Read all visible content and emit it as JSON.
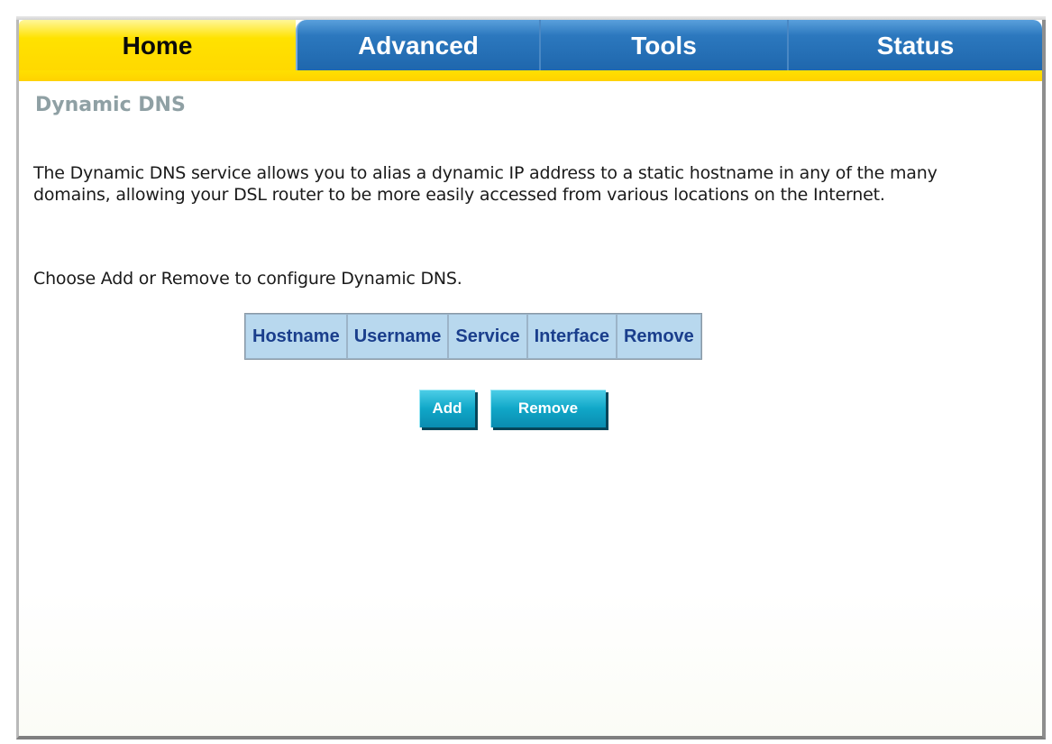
{
  "tabs": {
    "home": "Home",
    "advanced": "Advanced",
    "tools": "Tools",
    "status": "Status"
  },
  "page": {
    "title": "Dynamic DNS",
    "description": "The Dynamic DNS service allows you to alias a dynamic IP address to a static hostname in any of the many domains, allowing your DSL router to be more easily accessed from various locations on the Internet.",
    "instruction": "Choose Add or Remove to configure Dynamic DNS."
  },
  "table": {
    "columns": [
      "Hostname",
      "Username",
      "Service",
      "Interface",
      "Remove"
    ],
    "rows": []
  },
  "buttons": {
    "add": "Add",
    "remove": "Remove"
  },
  "colors": {
    "active_tab": "#ffe200",
    "inactive_tab": "#2c78be",
    "title": "#8fa0a4",
    "table_header_bg": "#b8d8ee",
    "table_header_text": "#1a3e8c",
    "button": "#10a7c8"
  }
}
